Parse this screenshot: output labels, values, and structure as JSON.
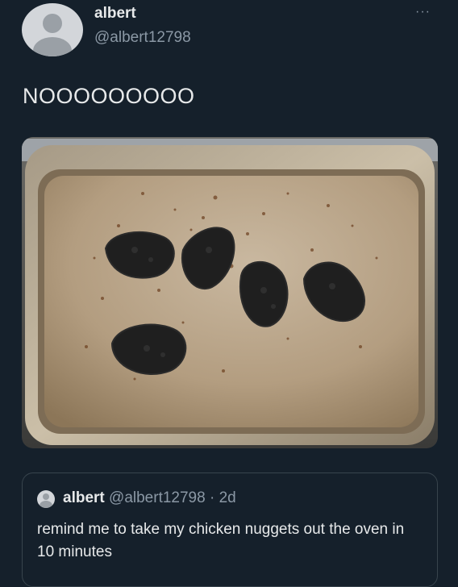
{
  "author": {
    "name": "albert",
    "handle": "@albert12798",
    "avatar_icon": "default-avatar-icon"
  },
  "menu_icon": "more-options-icon",
  "menu_label": "···",
  "tweet": {
    "text": "NOOOOOOOOO"
  },
  "media": {
    "description_icon": "photo-burnt-chicken-nuggets-on-tray"
  },
  "quoted_tweet": {
    "name": "albert",
    "handle": "@albert12798",
    "separator": "·",
    "time": "2d",
    "text": "remind me to take my chicken nuggets out the oven in 10 minutes"
  },
  "colors": {
    "background": "#15202b",
    "text_primary": "#e7e9ea",
    "text_secondary": "#8b98a5",
    "border": "#38444d"
  }
}
